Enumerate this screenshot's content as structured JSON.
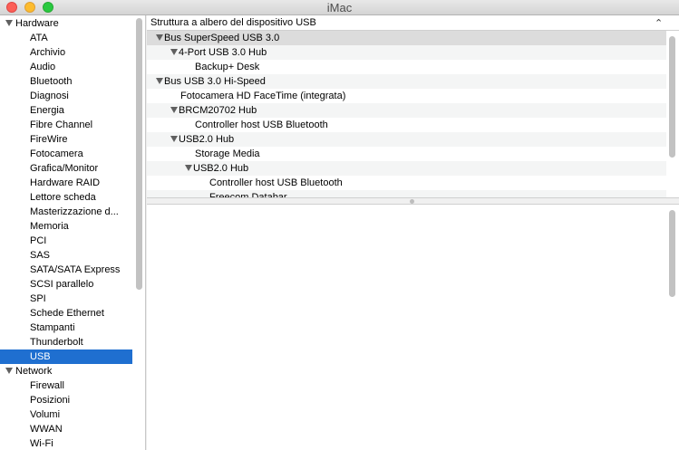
{
  "window": {
    "title": "iMac"
  },
  "sidebar": {
    "rows": [
      {
        "kind": "group",
        "label": "Hardware"
      },
      {
        "kind": "item",
        "label": "ATA"
      },
      {
        "kind": "item",
        "label": "Archivio"
      },
      {
        "kind": "item",
        "label": "Audio"
      },
      {
        "kind": "item",
        "label": "Bluetooth"
      },
      {
        "kind": "item",
        "label": "Diagnosi"
      },
      {
        "kind": "item",
        "label": "Energia"
      },
      {
        "kind": "item",
        "label": "Fibre Channel"
      },
      {
        "kind": "item",
        "label": "FireWire"
      },
      {
        "kind": "item",
        "label": "Fotocamera"
      },
      {
        "kind": "item",
        "label": "Grafica/Monitor"
      },
      {
        "kind": "item",
        "label": "Hardware RAID"
      },
      {
        "kind": "item",
        "label": "Lettore scheda"
      },
      {
        "kind": "item",
        "label": "Masterizzazione d..."
      },
      {
        "kind": "item",
        "label": "Memoria"
      },
      {
        "kind": "item",
        "label": "PCI"
      },
      {
        "kind": "item",
        "label": "SAS"
      },
      {
        "kind": "item",
        "label": "SATA/SATA Express"
      },
      {
        "kind": "item",
        "label": "SCSI parallelo"
      },
      {
        "kind": "item",
        "label": "SPI"
      },
      {
        "kind": "item",
        "label": "Schede Ethernet"
      },
      {
        "kind": "item",
        "label": "Stampanti"
      },
      {
        "kind": "item",
        "label": "Thunderbolt"
      },
      {
        "kind": "item",
        "label": "USB",
        "selected": true
      },
      {
        "kind": "group",
        "label": "Network"
      },
      {
        "kind": "item",
        "label": "Firewall"
      },
      {
        "kind": "item",
        "label": "Posizioni"
      },
      {
        "kind": "item",
        "label": "Volumi"
      },
      {
        "kind": "item",
        "label": "WWAN"
      },
      {
        "kind": "item",
        "label": "Wi-Fi"
      }
    ]
  },
  "tree": {
    "header": "Struttura a albero del dispositivo USB",
    "rows": [
      {
        "label": "Bus SuperSpeed USB 3.0",
        "level": 0,
        "expanded": true,
        "selected": true
      },
      {
        "label": "4-Port USB 3.0 Hub",
        "level": 1,
        "expanded": true
      },
      {
        "label": "Backup+ Desk",
        "level": 2
      },
      {
        "label": "Bus USB 3.0 Hi-Speed",
        "level": 0,
        "expanded": true
      },
      {
        "label": "Fotocamera HD FaceTime (integrata)",
        "level": 1
      },
      {
        "label": "BRCM20702 Hub",
        "level": 1,
        "expanded": true
      },
      {
        "label": "Controller host USB Bluetooth",
        "level": 2
      },
      {
        "label": "USB2.0 Hub",
        "level": 1,
        "expanded": true
      },
      {
        "label": "Storage Media",
        "level": 2
      },
      {
        "label": "USB2.0 Hub",
        "level": 2,
        "expanded": true
      },
      {
        "label": "Controller host USB Bluetooth",
        "level": 3
      },
      {
        "label": "Freecom Databar",
        "level": 3
      }
    ]
  }
}
